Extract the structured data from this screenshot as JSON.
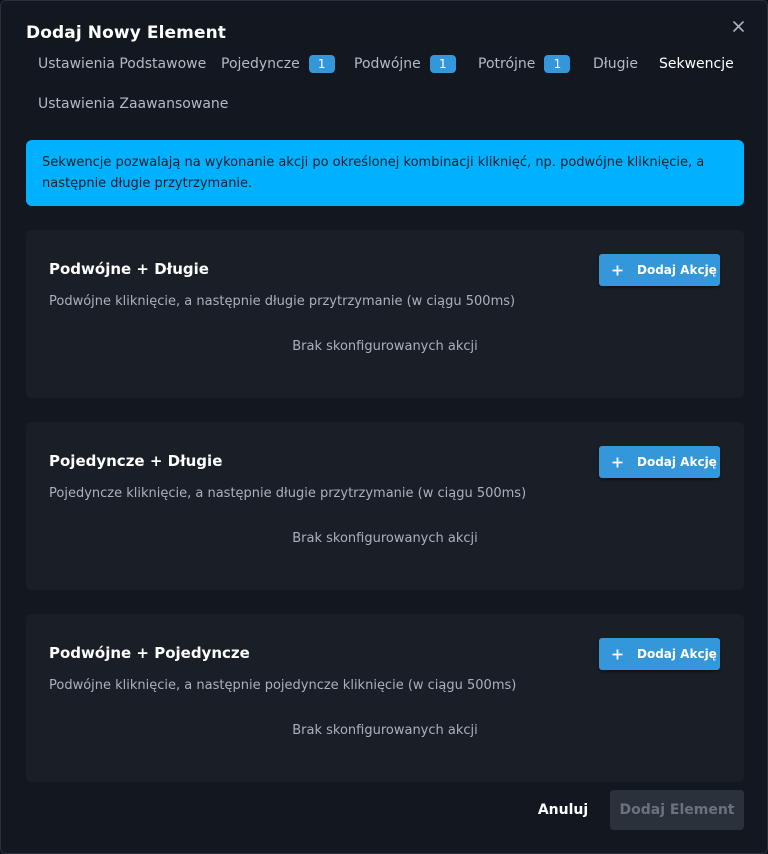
{
  "dialog": {
    "title": "Dodaj Nowy Element",
    "close_icon": "close-icon"
  },
  "tabs": [
    {
      "label": "Ustawienia Podstawowe",
      "badge": null,
      "active": false
    },
    {
      "label": "Pojedyncze",
      "badge": "1",
      "active": false
    },
    {
      "label": "Podwójne",
      "badge": "1",
      "active": false
    },
    {
      "label": "Potrójne",
      "badge": "1",
      "active": false
    },
    {
      "label": "Długie",
      "badge": null,
      "active": false
    },
    {
      "label": "Sekwencje",
      "badge": null,
      "active": true
    },
    {
      "label": "Ustawienia Zaawansowane",
      "badge": null,
      "active": false
    }
  ],
  "info": {
    "text": "Sekwencje pozwalają na wykonanie akcji po określonej kombinacji kliknięć, np. podwójne kliknięcie, a następnie długie przytrzymanie."
  },
  "sequences": [
    {
      "title": "Podwójne + Długie",
      "description": "Podwójne kliknięcie, a następnie długie przytrzymanie (w ciągu 500ms)",
      "empty": "Brak skonfigurowanych akcji",
      "button": "Dodaj Akcję"
    },
    {
      "title": "Pojedyncze + Długie",
      "description": "Pojedyncze kliknięcie, a następnie długie przytrzymanie (w ciągu 500ms)",
      "empty": "Brak skonfigurowanych akcji",
      "button": "Dodaj Akcję"
    },
    {
      "title": "Podwójne + Pojedyncze",
      "description": "Podwójne kliknięcie, a następnie pojedyncze kliknięcie (w ciągu 500ms)",
      "empty": "Brak skonfigurowanych akcji",
      "button": "Dodaj Akcję"
    }
  ],
  "footer": {
    "cancel": "Anuluj",
    "submit": "Dodaj Element"
  },
  "colors": {
    "accent": "#3497da",
    "info_bg": "#00b1ff",
    "card_bg": "#1a1f27",
    "dialog_bg": "#131820"
  }
}
